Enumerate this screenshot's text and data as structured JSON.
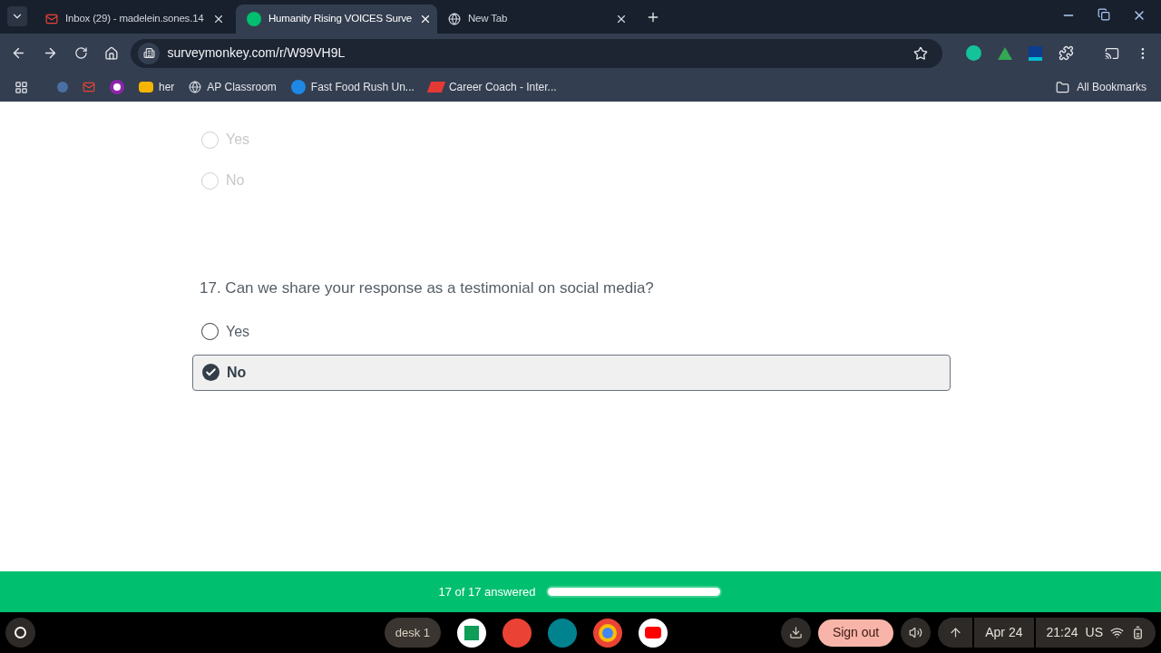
{
  "tabs": [
    {
      "title": "Inbox (29) - madelein.sones.14",
      "selected": false
    },
    {
      "title": "Humanity Rising VOICES Surve",
      "selected": true
    },
    {
      "title": "New Tab",
      "selected": false
    }
  ],
  "address": "surveymonkey.com/r/W99VH9L",
  "bookmarks": [
    "her",
    "AP Classroom",
    "Fast Food Rush Un...",
    "Career Coach - Inter..."
  ],
  "all_bookmarks": "All Bookmarks",
  "questions": [
    {
      "faded": true,
      "options": [
        {
          "label": "Yes",
          "selected": false
        },
        {
          "label": "No",
          "selected": false
        }
      ]
    },
    {
      "faded": false,
      "title": "17. Can we share your response as a testimonial on social media?",
      "options": [
        {
          "label": "Yes",
          "selected": false
        },
        {
          "label": "No",
          "selected": true
        }
      ]
    }
  ],
  "progress": {
    "text": "17 of 17 answered",
    "level": 1
  },
  "shelf": {
    "desk": "desk 1",
    "sign_out": "Sign out",
    "date": "Apr 24",
    "time": "21:24",
    "locale": "US"
  }
}
